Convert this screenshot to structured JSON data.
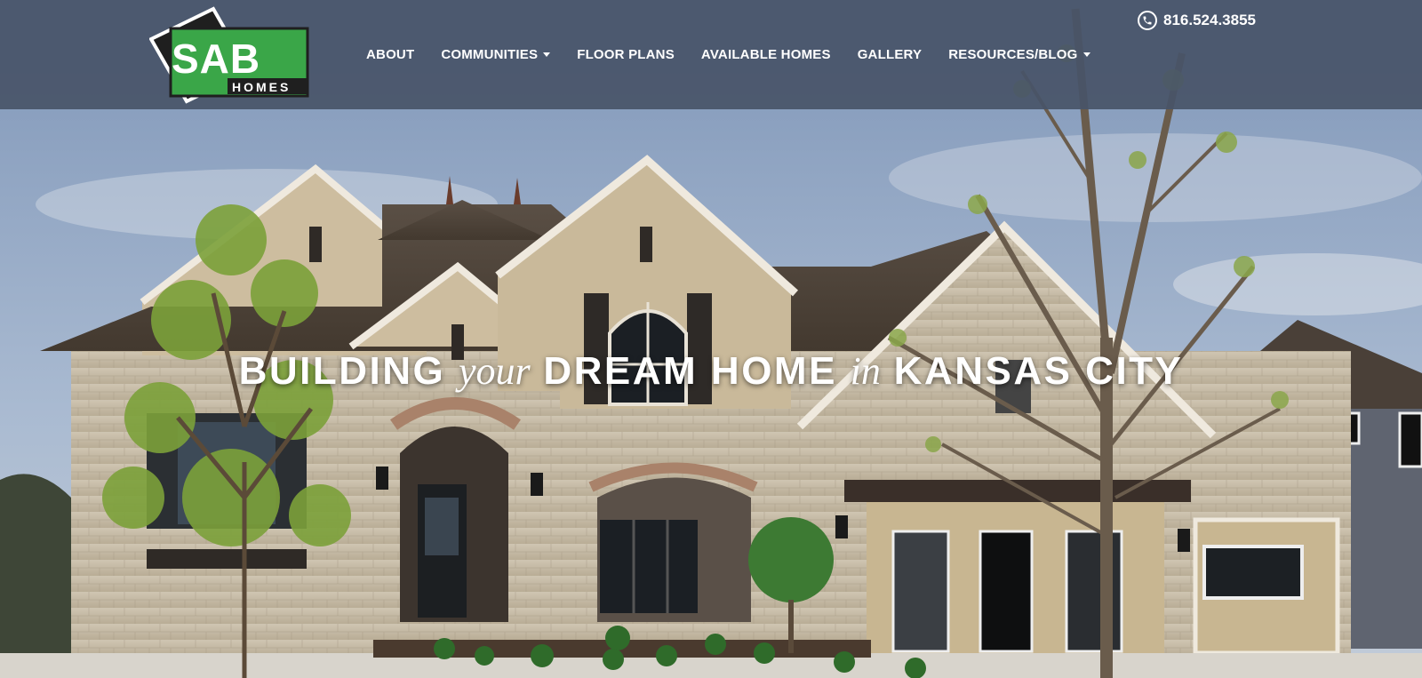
{
  "brand": {
    "logo_main": "SAB",
    "logo_sub": "HOMES"
  },
  "header": {
    "phone": "816.524.3855"
  },
  "nav": {
    "items": [
      {
        "label": "ABOUT",
        "has_dropdown": false
      },
      {
        "label": "COMMUNITIES",
        "has_dropdown": true
      },
      {
        "label": "FLOOR PLANS",
        "has_dropdown": false
      },
      {
        "label": "AVAILABLE HOMES",
        "has_dropdown": false
      },
      {
        "label": "GALLERY",
        "has_dropdown": false
      },
      {
        "label": "RESOURCES/BLOG",
        "has_dropdown": true
      }
    ]
  },
  "hero": {
    "headline_part1": "BUILDING",
    "headline_part2": "your",
    "headline_part3": "DREAM HOME",
    "headline_part4": "in",
    "headline_part5": "KANSAS CITY",
    "image": "house-exterior-photo"
  },
  "colors": {
    "nav_bar": "#485468",
    "logo_green": "#3aa648",
    "logo_dark": "#222222",
    "text": "#ffffff"
  }
}
